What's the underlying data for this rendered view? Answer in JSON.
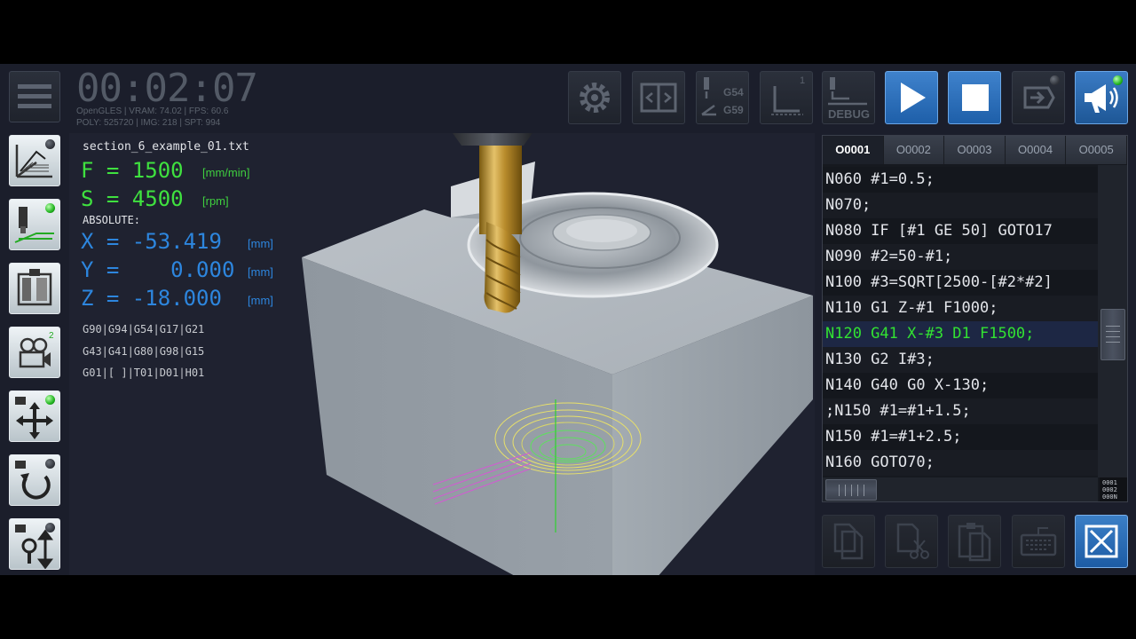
{
  "app": {
    "timer": "00:02:07",
    "stats_line1": "OpenGLES | VRAM: 74.02 | FPS: 60.6",
    "stats_line2": "POLY: 525720 | IMG: 218 | SPT: 994"
  },
  "toolbar": {
    "menu_icon": "hamburger-menu-icon",
    "settings_icon": "gear-icon",
    "mirror_icon": "split-view-icon",
    "wcs_labels": [
      "G54",
      "G59"
    ],
    "single_block_label": "1",
    "debug_label": "DEBUG",
    "play_icon": "play-icon",
    "stop_icon": "stop-icon",
    "export_icon": "export-icon",
    "audio_icon": "megaphone-icon"
  },
  "sidebar": {
    "items": [
      {
        "name": "grid-3d-icon",
        "active": true,
        "led": "off"
      },
      {
        "name": "tool-path-icon",
        "active": true,
        "led": "on"
      },
      {
        "name": "machine-icon",
        "active": true,
        "led": "none"
      },
      {
        "name": "camera-icon",
        "active": true,
        "badge": "2"
      },
      {
        "name": "camera-pan-icon",
        "active": true,
        "led": "on"
      },
      {
        "name": "camera-rotate-icon",
        "active": true,
        "led": "off"
      },
      {
        "name": "camera-zoom-icon",
        "active": true,
        "led": "off"
      }
    ]
  },
  "readout": {
    "filename": "section_6_example_01.txt",
    "feed_label": "F = 1500",
    "feed_unit": "[mm/min]",
    "speed_label": "S = 4500",
    "speed_unit": "[rpm]",
    "mode": "ABSOLUTE:",
    "x_line": "X = -53.419",
    "y_line": "Y =    0.000",
    "z_line": "Z = -18.000",
    "axis_unit": "[mm]",
    "gcodes": [
      "G90|G94|G54|G17|G21",
      "G43|G41|G80|G98|G15",
      "G01|[ ]|T01|D01|H01"
    ]
  },
  "editor": {
    "tabs": [
      "O0001",
      "O0002",
      "O0003",
      "O0004",
      "O0005"
    ],
    "active_tab": 0,
    "lines": [
      "N060 #1=0.5;",
      "N070;",
      "N080 IF [#1 GE 50] GOTO17",
      "N090 #2=50-#1;",
      "N100 #3=SQRT[2500-[#2*#2]",
      "N110 G1 Z-#1 F1000;",
      "N120 G41 X-#3 D1 F1500;",
      "N130 G2 I#3;",
      "N140 G40 G0 X-130;",
      ";N150 #1=#1+1.5;",
      "N150 #1=#1+2.5;",
      "N160 GOTO70;"
    ],
    "highlight_index": 6,
    "line_number_icon": [
      "0001",
      "0002",
      "000N"
    ]
  },
  "bottom": {
    "copy_icon": "copy-icon",
    "cut_icon": "cut-icon",
    "paste_icon": "paste-icon",
    "keyboard_icon": "keyboard-icon",
    "close_icon": "close-icon"
  },
  "colors": {
    "accent_blue": "#2d86de",
    "active_green": "#3fe13f",
    "panel_bg": "#1b1e2b"
  }
}
